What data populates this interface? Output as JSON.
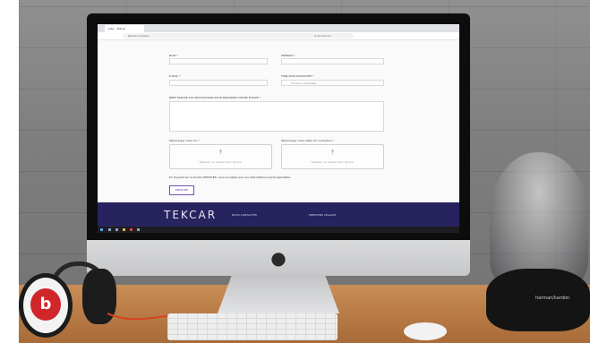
{
  "browser": {
    "tab_title": "Jobs – Tekcar",
    "url": "tekcar.com/jobs",
    "search_placeholder": "Q Recherche"
  },
  "form": {
    "nom_label": "NOM *",
    "prenom_label": "PRÉNOM *",
    "email_label": "E-MAIL *",
    "fonction_label": "FONCTION SOUHAITÉE *",
    "fonction_value": "Fonction souhaitée",
    "motivation_label": "BREF EXPOSÉ VOS MOTIVATIONS POUR REJOINDRE NOTRE ÉQUIPE *",
    "cv_label": "Télécharger votre CV *",
    "letter_label": "Télécharger votre lettre de motivation *",
    "cv_drop_text": "Déposer ou cliquer pour ajouter",
    "letter_drop_text": "Déposer ou cliquer pour ajouter",
    "privacy_text": "En cliquant sur le bouton ENVOYER, vous acceptez que vos informations soient exploitées.",
    "submit_label": "ENVOYER"
  },
  "footer": {
    "brand": "TEKCAR",
    "link_1": "NOUS CONTACTER",
    "link_2": "MENTIONS LÉGALES"
  },
  "speaker_brand": "harman/kardon",
  "headphone_logo": "b",
  "icons": [
    "apple-icon",
    "upload-icon",
    "chevron-down-icon",
    "windows-icon"
  ],
  "colors": {
    "footer_bg": "#27235f",
    "submit_accent": "#7b4fb0",
    "desk": "#b77a45",
    "wall": "#7e7f7e"
  }
}
